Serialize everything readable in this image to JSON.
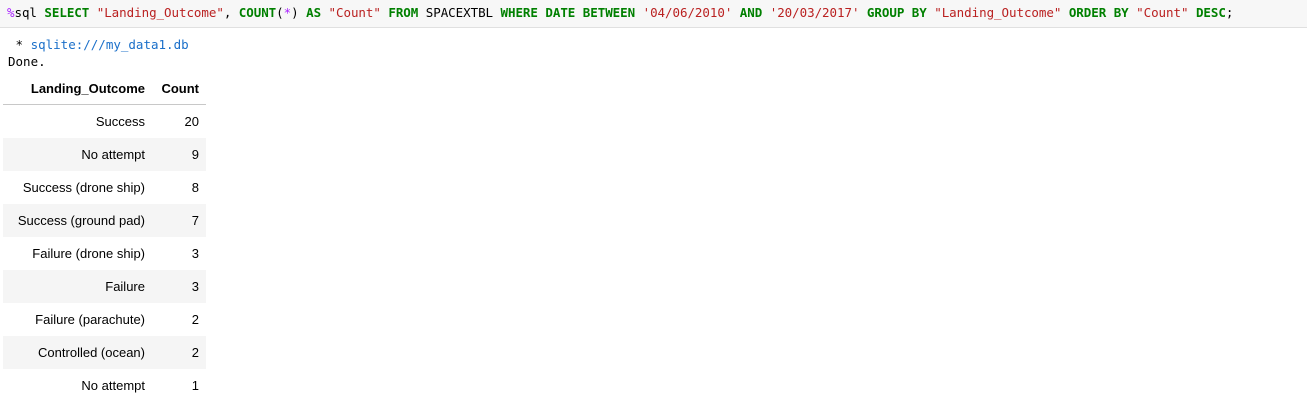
{
  "input": {
    "code_tokens": [
      {
        "t": "%",
        "c": "magic"
      },
      {
        "t": "sql ",
        "c": "id"
      },
      {
        "t": "SELECT",
        "c": "kw"
      },
      {
        "t": " ",
        "c": "id"
      },
      {
        "t": "\"Landing_Outcome\"",
        "c": "str"
      },
      {
        "t": ", ",
        "c": "punct"
      },
      {
        "t": "COUNT",
        "c": "kw"
      },
      {
        "t": "(",
        "c": "punct"
      },
      {
        "t": "*",
        "c": "op"
      },
      {
        "t": ") ",
        "c": "punct"
      },
      {
        "t": "AS",
        "c": "kw"
      },
      {
        "t": " ",
        "c": "id"
      },
      {
        "t": "\"Count\"",
        "c": "str"
      },
      {
        "t": " ",
        "c": "id"
      },
      {
        "t": "FROM",
        "c": "kw"
      },
      {
        "t": " SPACEXTBL ",
        "c": "id"
      },
      {
        "t": "WHERE",
        "c": "kw"
      },
      {
        "t": " ",
        "c": "id"
      },
      {
        "t": "DATE",
        "c": "kw"
      },
      {
        "t": " ",
        "c": "id"
      },
      {
        "t": "BETWEEN",
        "c": "kw"
      },
      {
        "t": " ",
        "c": "id"
      },
      {
        "t": "'04/06/2010'",
        "c": "str"
      },
      {
        "t": " ",
        "c": "id"
      },
      {
        "t": "AND",
        "c": "kw"
      },
      {
        "t": " ",
        "c": "id"
      },
      {
        "t": "'20/03/2017'",
        "c": "str"
      },
      {
        "t": " ",
        "c": "id"
      },
      {
        "t": "GROUP",
        "c": "kw"
      },
      {
        "t": " ",
        "c": "id"
      },
      {
        "t": "BY",
        "c": "kw"
      },
      {
        "t": " ",
        "c": "id"
      },
      {
        "t": "\"Landing_Outcome\"",
        "c": "str"
      },
      {
        "t": " ",
        "c": "id"
      },
      {
        "t": "ORDER",
        "c": "kw"
      },
      {
        "t": " ",
        "c": "id"
      },
      {
        "t": "BY",
        "c": "kw"
      },
      {
        "t": " ",
        "c": "id"
      },
      {
        "t": "\"Count\"",
        "c": "str"
      },
      {
        "t": " ",
        "c": "id"
      },
      {
        "t": "DESC",
        "c": "kw"
      },
      {
        "t": ";",
        "c": "punct"
      }
    ]
  },
  "output": {
    "connection_prefix": " * ",
    "connection": "sqlite:///my_data1.db",
    "status": "Done."
  },
  "table": {
    "headers": [
      "Landing_Outcome",
      "Count"
    ],
    "rows": [
      [
        "Success",
        "20"
      ],
      [
        "No attempt",
        "9"
      ],
      [
        "Success (drone ship)",
        "8"
      ],
      [
        "Success (ground pad)",
        "7"
      ],
      [
        "Failure (drone ship)",
        "3"
      ],
      [
        "Failure",
        "3"
      ],
      [
        "Failure (parachute)",
        "2"
      ],
      [
        "Controlled (ocean)",
        "2"
      ],
      [
        "No attempt",
        "1"
      ]
    ]
  },
  "colors": {
    "keyword": "#008000",
    "string": "#ba2121",
    "magic": "#aa22ff",
    "link": "#1a6fc9",
    "input_bg": "#f7f7f7",
    "row_stripe": "#f5f5f5"
  }
}
